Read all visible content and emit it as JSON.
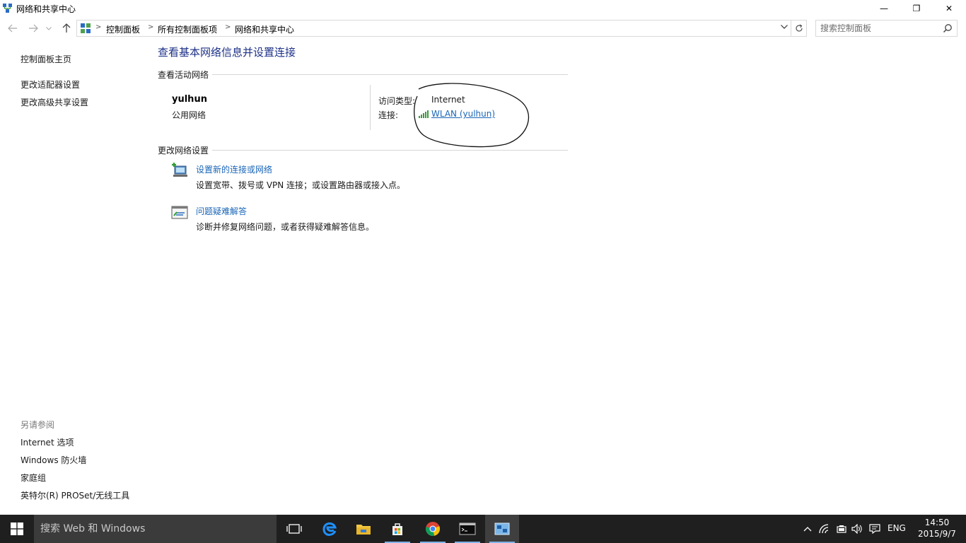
{
  "window": {
    "title": "网络和共享中心",
    "min_glyph": "—",
    "max_glyph": "❐",
    "close_glyph": "✕"
  },
  "address": {
    "crumbs": [
      "控制面板",
      "所有控制面板项",
      "网络和共享中心"
    ],
    "search_placeholder": "搜索控制面板"
  },
  "left_pane": {
    "links": [
      "控制面板主页",
      "更改适配器设置",
      "更改高级共享设置"
    ],
    "see_also_title": "另请参阅",
    "see_also": [
      "Internet 选项",
      "Windows 防火墙",
      "家庭组",
      "英特尔(R) PROSet/无线工具"
    ]
  },
  "main": {
    "heading": "查看基本网络信息并设置连接",
    "active_section": "查看活动网络",
    "network": {
      "name": "yulhun",
      "type": "公用网络",
      "access_label": "访问类型:",
      "access_value": "Internet",
      "connection_label": "连接:",
      "connection_value": "WLAN (yulhun)"
    },
    "change_section": "更改网络设置",
    "tasks": [
      {
        "title": "设置新的连接或网络",
        "desc": "设置宽带、拨号或 VPN 连接；或设置路由器或接入点。",
        "icon": "new-connection-icon"
      },
      {
        "title": "问题疑难解答",
        "desc": "诊断并修复网络问题，或者获得疑难解答信息。",
        "icon": "troubleshoot-icon"
      }
    ]
  },
  "taskbar": {
    "search_placeholder": "搜索 Web 和 Windows",
    "language": "ENG",
    "time": "14:50",
    "date": "2015/9/7"
  },
  "colors": {
    "link_blue": "#1a66b8",
    "heading_blue": "#1e3287",
    "taskbar": "#1f1f1f"
  }
}
